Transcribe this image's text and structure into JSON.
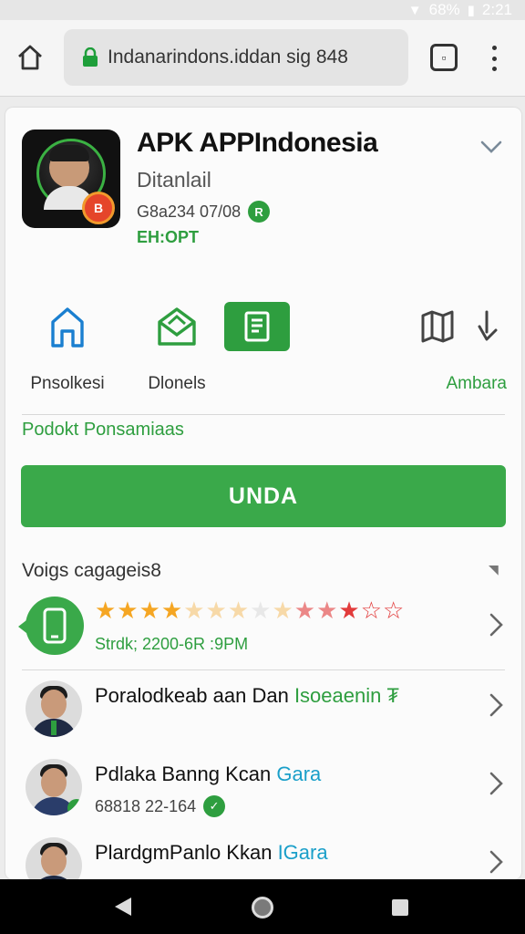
{
  "status_bar": {
    "battery": "68%",
    "time": "2:21"
  },
  "browser": {
    "url": "Indanarindons.iddan sig 848",
    "tabs_count": ""
  },
  "app": {
    "title": "APK APPIndonesia",
    "subtitle": "Ditanlail",
    "meta": "G8a234 07/08",
    "meta_badge": "R",
    "tag": "EH:OPT",
    "icon_coin": "B"
  },
  "actions": [
    {
      "label": "Pnsolkesi",
      "icon": "home-outline-icon"
    },
    {
      "label": "Dlonels",
      "icon": "envelope-open-icon"
    },
    {
      "label": "",
      "icon": "document-icon"
    },
    {
      "label": "Ambara",
      "icon": "map-icon"
    }
  ],
  "section_link": "Podokt Ponsamiaas",
  "install_button": "UNDA",
  "section_title": "Voigs cagageis8",
  "rating_item": {
    "meta": "Strdk; 2200-6R :9PM"
  },
  "list": [
    {
      "title": "Poralodkeab aan Dan ",
      "title_accent": "Isoeaenin ₮",
      "meta": ""
    },
    {
      "title": "Pdlaka Banng Kcan ",
      "title_accent": "Gara",
      "meta": "68818 22-164"
    },
    {
      "title": "PlardgmPanlo Kkan ",
      "title_accent": "IGara",
      "meta": ""
    }
  ],
  "colors": {
    "accent": "#2e9e3f",
    "link": "#1a9fc9",
    "install": "#3aa94a"
  }
}
